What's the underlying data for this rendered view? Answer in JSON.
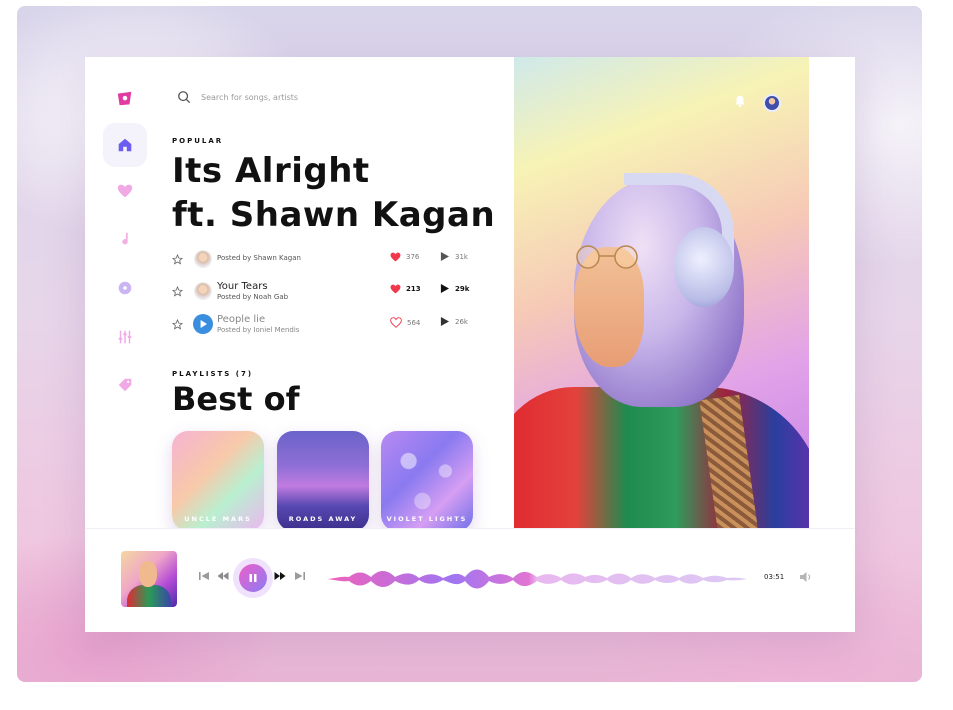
{
  "search": {
    "placeholder": "Search for songs, artists"
  },
  "popular": {
    "eyebrow": "POPULAR",
    "title_line1": "Its Alright",
    "title_line2": "ft. Shawn Kagan"
  },
  "tracks": [
    {
      "name": "",
      "posted_by": "Posted by Shawn Kagan",
      "likes": "376",
      "plays": "31k",
      "liked": true,
      "bold_stats": false
    },
    {
      "name": "Your Tears",
      "posted_by": "Posted by Noah Gab",
      "likes": "213",
      "plays": "29k",
      "liked": true,
      "bold_stats": true
    },
    {
      "name": "People lie",
      "posted_by": "Posted by Ioniel Mendis",
      "likes": "564",
      "plays": "26k",
      "liked": false,
      "bold_stats": false
    }
  ],
  "playlists": {
    "eyebrow": "PLAYLISTS (7)",
    "title": "Best of",
    "items": [
      {
        "label": "UNCLE MARS"
      },
      {
        "label": "ROADS AWAY"
      },
      {
        "label": "VIOLET LIGHTS"
      }
    ]
  },
  "player": {
    "time": "03:51",
    "state": "playing",
    "progress": 0.5
  },
  "colors": {
    "accent_pink": "#ef5fc8",
    "accent_purple": "#8a7cf4",
    "heart_red": "#f2374b",
    "brand": "#e03aa3"
  },
  "icons": {
    "sidebar": [
      "logo-icon",
      "home-icon",
      "heart-icon",
      "music-note-icon",
      "disc-icon",
      "equalizer-icon",
      "tag-icon"
    ],
    "header": [
      "search-icon",
      "bell-icon",
      "avatar"
    ],
    "player": [
      "skip-previous-icon",
      "rewind-icon",
      "pause-icon",
      "fast-forward-icon",
      "skip-next-icon",
      "volume-icon"
    ]
  }
}
